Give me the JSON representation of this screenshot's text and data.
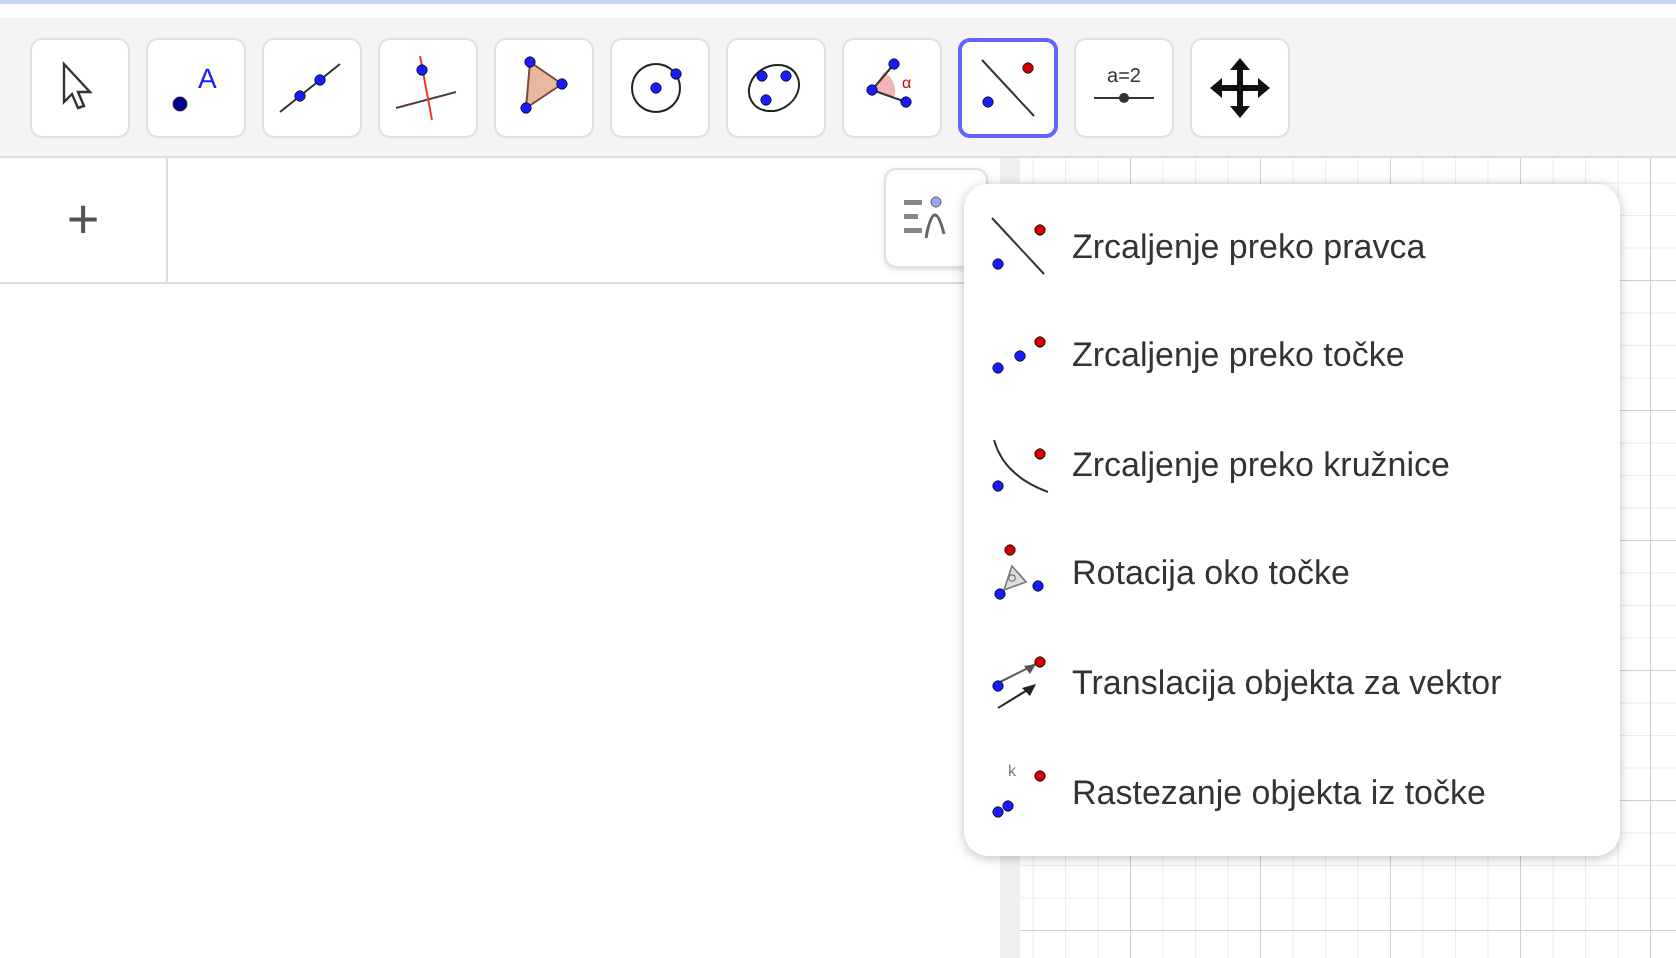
{
  "toolbar": {
    "tools": [
      {
        "kind": "move",
        "selected": false
      },
      {
        "kind": "point",
        "glyph": "A",
        "selected": false
      },
      {
        "kind": "line",
        "selected": false
      },
      {
        "kind": "perpendicular",
        "selected": false
      },
      {
        "kind": "polygon",
        "selected": false
      },
      {
        "kind": "circle",
        "selected": false
      },
      {
        "kind": "conic",
        "selected": false
      },
      {
        "kind": "angle",
        "glyph": "α",
        "selected": false
      },
      {
        "kind": "reflect-line",
        "selected": true
      },
      {
        "kind": "slider",
        "glyph": "a=2",
        "selected": false
      },
      {
        "kind": "pan",
        "selected": false
      }
    ]
  },
  "algebra": {
    "add_button": "+"
  },
  "transform_menu": {
    "items": [
      {
        "kind": "reflect-line",
        "label": "Zrcaljenje preko pravca"
      },
      {
        "kind": "reflect-point",
        "label": "Zrcaljenje preko točke"
      },
      {
        "kind": "reflect-circle",
        "label": "Zrcaljenje preko kružnice"
      },
      {
        "kind": "rotate",
        "label": "Rotacija oko točke"
      },
      {
        "kind": "translate",
        "label": "Translacija objekta za vektor"
      },
      {
        "kind": "dilate",
        "glyph": "k",
        "label": "Rastezanje objekta iz točke"
      }
    ]
  }
}
